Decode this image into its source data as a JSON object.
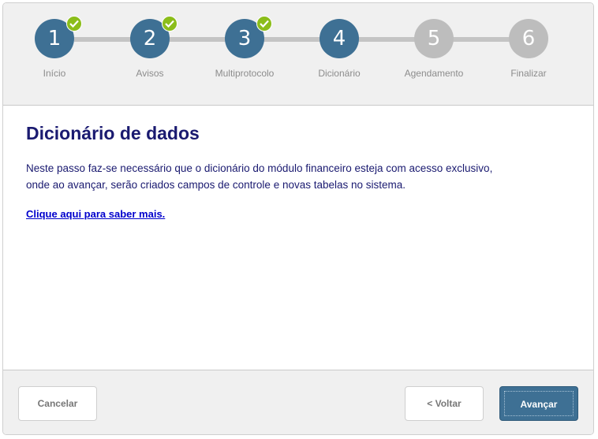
{
  "steps": [
    {
      "number": "1",
      "label": "Início",
      "state": "done"
    },
    {
      "number": "2",
      "label": "Avisos",
      "state": "done"
    },
    {
      "number": "3",
      "label": "Multiprotocolo",
      "state": "done"
    },
    {
      "number": "4",
      "label": "Dicionário",
      "state": "current"
    },
    {
      "number": "5",
      "label": "Agendamento",
      "state": "pending"
    },
    {
      "number": "6",
      "label": "Finalizar",
      "state": "pending"
    }
  ],
  "content": {
    "title": "Dicionário de dados",
    "description_line1": "Neste passo faz-se necessário que o dicionário do módulo financeiro esteja com acesso exclusivo,",
    "description_line2": "onde ao avançar, serão criados campos de controle e novas tabelas no sistema.",
    "link": "Clique aqui para saber mais."
  },
  "footer": {
    "cancel_label": "Cancelar",
    "back_label": "< Voltar",
    "next_label": "Avançar"
  },
  "colors": {
    "step_active": "#3e7094",
    "step_pending": "#bdbdbd",
    "check_badge": "#8bbd1a",
    "title_text": "#1a1a70",
    "link": "#0000cc"
  }
}
